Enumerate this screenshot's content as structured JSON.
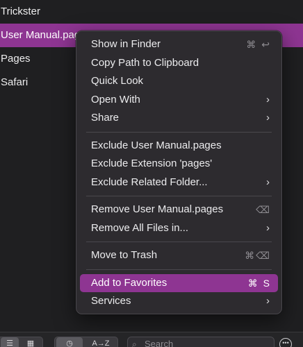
{
  "list": {
    "rows": [
      {
        "label": "Trickster",
        "selected": false
      },
      {
        "label": "User Manual.pages",
        "selected": true
      },
      {
        "label": "Pages",
        "selected": false
      },
      {
        "label": "Safari",
        "selected": false
      }
    ]
  },
  "menu": {
    "show_in_finder": {
      "label": "Show in Finder",
      "shortcut": "⌘ ↩"
    },
    "copy_path": {
      "label": "Copy Path to Clipboard"
    },
    "quick_look": {
      "label": "Quick Look"
    },
    "open_with": {
      "label": "Open With",
      "submenu": "›"
    },
    "share": {
      "label": "Share",
      "submenu": "›"
    },
    "exclude_file": {
      "label": "Exclude User Manual.pages"
    },
    "exclude_ext": {
      "label": "Exclude Extension 'pages'"
    },
    "exclude_folder": {
      "label": "Exclude Related Folder...",
      "submenu": "›"
    },
    "remove_file": {
      "label": "Remove User Manual.pages",
      "shortcut": "⌫"
    },
    "remove_all": {
      "label": "Remove All Files in...",
      "submenu": "›"
    },
    "move_trash": {
      "label": "Move to Trash",
      "shortcut": "⌘⌫"
    },
    "add_favorites": {
      "label": "Add to Favorites",
      "shortcut": "⌘ S"
    },
    "services": {
      "label": "Services",
      "submenu": "›"
    }
  },
  "toolbar": {
    "sort_az_label": "A→Z",
    "search_placeholder": "Search"
  },
  "colors": {
    "accent": "#8e3592",
    "menu_bg": "#2d2b2f",
    "window_bg": "#1f1f21"
  }
}
